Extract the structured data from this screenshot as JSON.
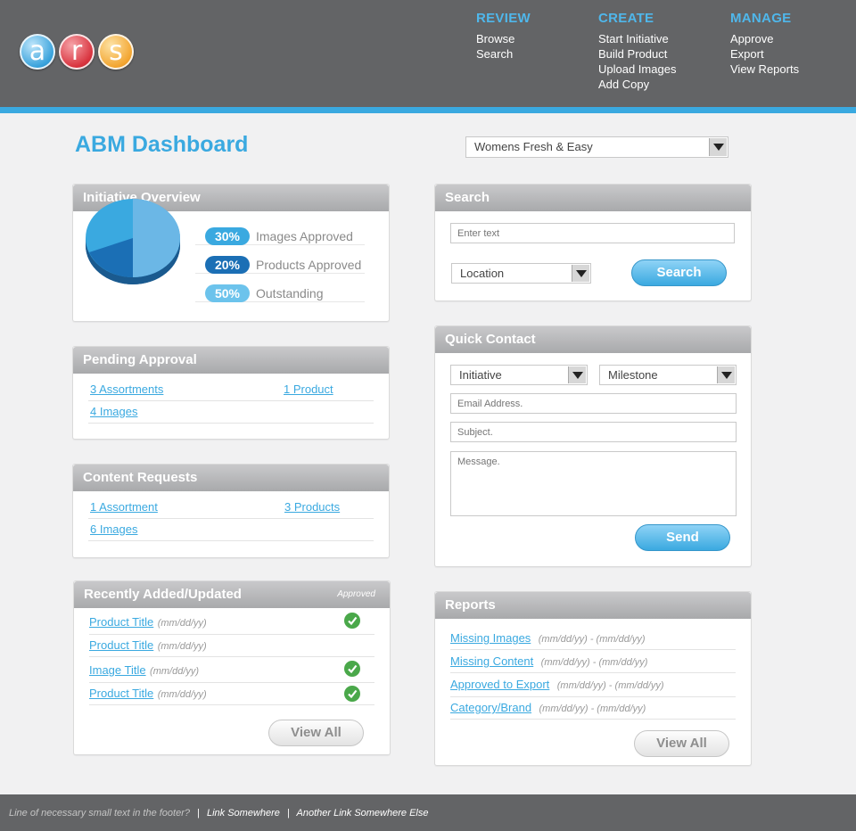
{
  "header": {
    "logo_letters": [
      "a",
      "r",
      "s"
    ],
    "nav": [
      {
        "title": "REVIEW",
        "links": [
          "Browse",
          "Search"
        ]
      },
      {
        "title": "CREATE",
        "links": [
          "Start Initiative",
          "Build Product",
          "Upload Images",
          "Add Copy"
        ]
      },
      {
        "title": "MANAGE",
        "links": [
          "Approve",
          "Export",
          "View Reports"
        ]
      }
    ]
  },
  "page": {
    "title": "ABM Dashboard",
    "brand_select": "Womens Fresh & Easy"
  },
  "initiative_overview": {
    "title": "Initiative Overview",
    "stats": [
      {
        "pct": "30%",
        "label": "Images Approved",
        "color": "#3aa9e0"
      },
      {
        "pct": "20%",
        "label": "Products Approved",
        "color": "#1b6fb5"
      },
      {
        "pct": "50%",
        "label": "Outstanding",
        "color": "#6cc3ec"
      }
    ]
  },
  "pending_approval": {
    "title": "Pending Approval",
    "links": [
      "3 Assortments",
      "1 Product",
      "4 Images"
    ]
  },
  "content_requests": {
    "title": "Content Requests",
    "links": [
      "1 Assortment",
      "3 Products",
      "6 Images"
    ]
  },
  "recently_added": {
    "title": "Recently Added/Updated",
    "approved_header": "Approved",
    "rows": [
      {
        "title": "Product Title",
        "date": "(mm/dd/yy)",
        "approved": true
      },
      {
        "title": "Product Title",
        "date": "(mm/dd/yy)",
        "approved": false
      },
      {
        "title": "Image Title",
        "date": "(mm/dd/yy)",
        "approved": true
      },
      {
        "title": "Product Title",
        "date": "(mm/dd/yy)",
        "approved": true
      }
    ],
    "view_all": "View All"
  },
  "search": {
    "title": "Search",
    "placeholder": "Enter text",
    "location_select": "Location",
    "button": "Search"
  },
  "quick_contact": {
    "title": "Quick Contact",
    "initiative_select": "Initiative",
    "milestone_select": "Milestone",
    "email_placeholder": "Email Address.",
    "subject_placeholder": "Subject.",
    "message_placeholder": "Message.",
    "button": "Send"
  },
  "reports": {
    "title": "Reports",
    "rows": [
      {
        "title": "Missing Images",
        "range": "(mm/dd/yy) - (mm/dd/yy)"
      },
      {
        "title": "Missing Content",
        "range": "(mm/dd/yy) - (mm/dd/yy)"
      },
      {
        "title": "Approved to Export",
        "range": "(mm/dd/yy) - (mm/dd/yy)"
      },
      {
        "title": "Category/Brand",
        "range": "(mm/dd/yy) - (mm/dd/yy)"
      }
    ],
    "view_all": "View All"
  },
  "footer": {
    "text": "Line of necessary small text in the footer?",
    "link1": "Link Somewhere",
    "link2": "Another Link Somewhere Else",
    "separator": "|"
  }
}
